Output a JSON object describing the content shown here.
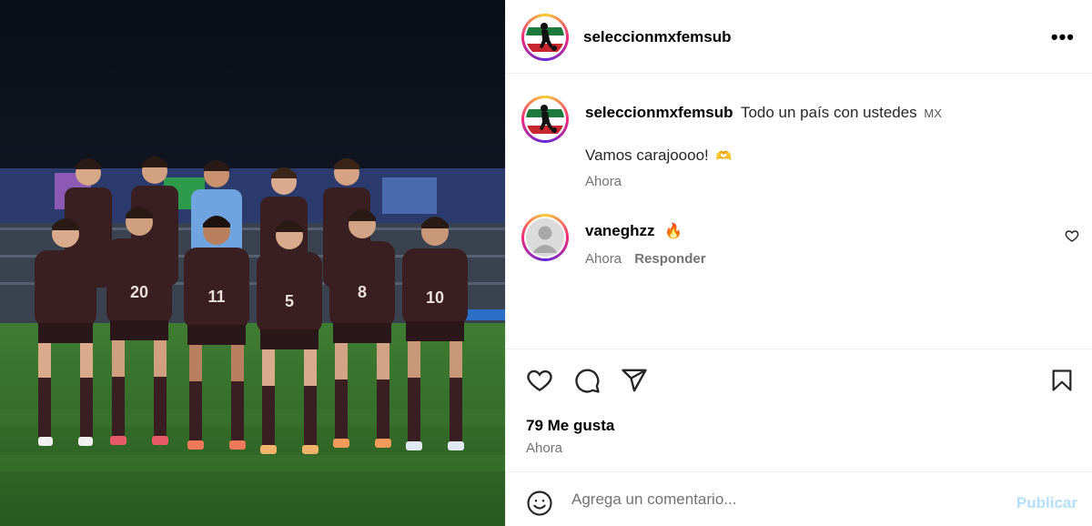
{
  "post": {
    "author": "seleccionmxfemsub",
    "more_label": "•••",
    "caption_line1": "Todo un país con ustedes",
    "caption_flag": "MX",
    "caption_line2": "Vamos carajoooo!",
    "caption_emoji": "🫶",
    "caption_time": "Ahora",
    "likes": "79 Me gusta",
    "post_time": "Ahora"
  },
  "comments": [
    {
      "user": "vaneghzz",
      "emoji": "🔥",
      "time": "Ahora",
      "reply_label": "Responder"
    }
  ],
  "add_comment": {
    "placeholder": "Agrega un comentario...",
    "publish_label": "Publicar"
  },
  "icons": {
    "like": "heart-icon",
    "comment": "comment-bubble-icon",
    "share": "paper-plane-icon",
    "save": "bookmark-icon",
    "emoji": "smiley-icon",
    "more": "more-options-icon"
  },
  "colors": {
    "publish_disabled": "#b2dffc",
    "secondary_text": "#737373",
    "divider": "#efefef",
    "jersey": "#3a1f22",
    "pitch": "#2f6a2a"
  }
}
